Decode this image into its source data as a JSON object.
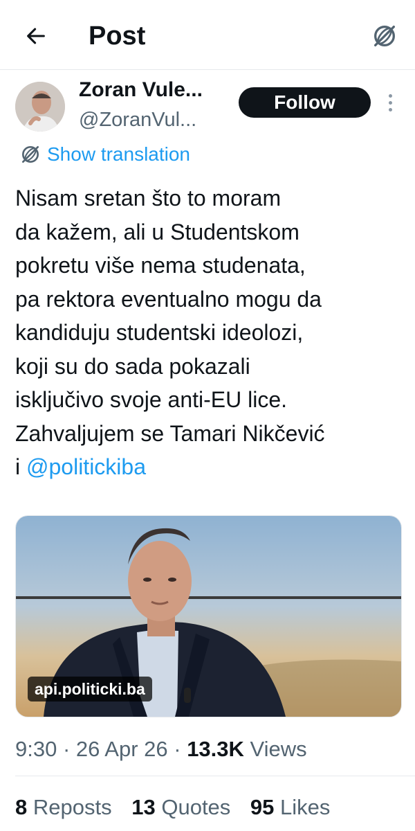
{
  "header": {
    "title": "Post",
    "back_icon": "arrow-left-icon",
    "right_icon": "globe-translate-icon"
  },
  "author": {
    "name": "Zoran Vule...",
    "handle": "@ZoranVul...",
    "follow_label": "Follow"
  },
  "translate": {
    "label": "Show translation"
  },
  "tweet": {
    "text": "Nisam sretan što to moram\nda kažem, ali u Studentskom\npokretu više nema studenata,\npa rektora eventualno mogu da\nkandiduju studentski ideolozi,\nkoji su do sada pokazali\nisključivo svoje anti-EU lice.\nZahvaljujem se Tamari Nikčević\ni ",
    "mention": "@politickiba"
  },
  "media": {
    "domain": "api.politicki.ba"
  },
  "meta": {
    "time": "9:30",
    "date": "26 Apr 26",
    "views_count": "13.3K",
    "views_label": "Views"
  },
  "stats": {
    "reposts_count": "8",
    "reposts_label": "Reposts",
    "quotes_count": "13",
    "quotes_label": "Quotes",
    "likes_count": "95",
    "likes_label": "Likes"
  },
  "colors": {
    "accent": "#1d9bf0",
    "text": "#0f1419",
    "muted": "#536471",
    "button": "#0f1419"
  }
}
